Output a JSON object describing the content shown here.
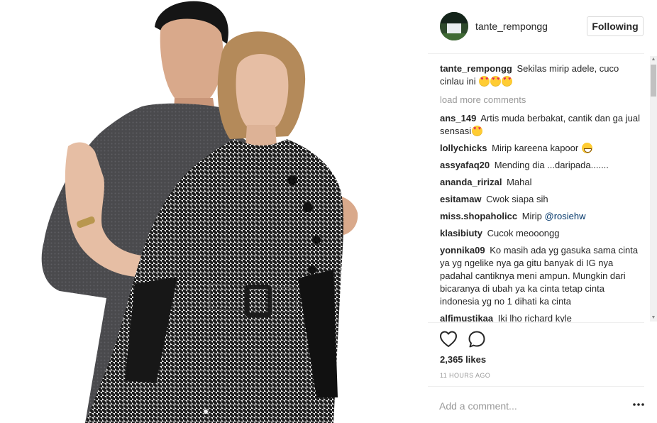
{
  "post": {
    "username": "tante_rempongg",
    "follow_label": "Following",
    "load_more": "load more comments",
    "likes": "2,365 likes",
    "timestamp": "11 HOURS AGO",
    "comment_placeholder": "Add a comment..."
  },
  "caption": {
    "user": "tante_rempongg",
    "text": "Sekilas mirip adele, cuco cinlau ini"
  },
  "comments": [
    {
      "user": "ans_149",
      "text": "Artis muda berbakat, cantik dan ga jual sensasi"
    },
    {
      "user": "lollychicks",
      "text": "Mirip kareena kapoor"
    },
    {
      "user": "assyafaq20",
      "text": "Mending dia ...daripada......."
    },
    {
      "user": "ananda_ririzal",
      "text": "Mahal"
    },
    {
      "user": "esitamaw",
      "text": "Cwok siapa sih"
    },
    {
      "user": "miss.shopaholicc",
      "text": "Mirip",
      "mention": "@rosiehw"
    },
    {
      "user": "klasibiuty",
      "text": "Cucok meooongg"
    },
    {
      "user": "yonnika09",
      "text": "Ko masih ada yg gasuka sama cinta ya yg ngelike nya ga gitu banyak di IG nya padahal cantiknya meni ampun. Mungkin dari bicaranya di ubah ya ka cinta tetap cinta indonesia yg no 1 dihati ka cinta"
    },
    {
      "user": "alfimustikaa",
      "text": "Iki lho richard kyle"
    }
  ],
  "icons": {
    "like": "heart-icon",
    "comment": "comment-bubble-icon",
    "more": "more-options-icon",
    "emoji_heart_eyes": "heart-eyes-emoji-icon",
    "emoji_grin": "grinning-emoji-icon"
  },
  "colors": {
    "text": "#262626",
    "muted": "#999999",
    "mention": "#003569",
    "border": "#efefef"
  }
}
